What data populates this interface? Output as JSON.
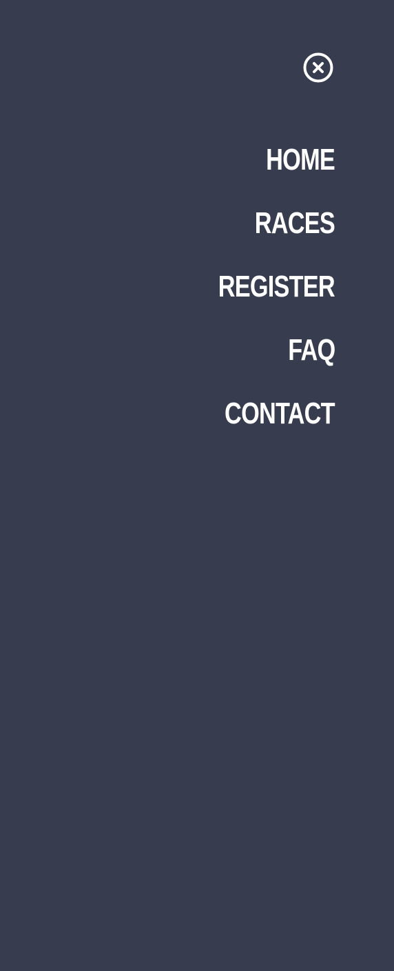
{
  "menu": {
    "close_icon": "close-circle-icon",
    "items": [
      {
        "label": "HOME"
      },
      {
        "label": "RACES"
      },
      {
        "label": "REGISTER"
      },
      {
        "label": "FAQ"
      },
      {
        "label": "CONTACT"
      }
    ]
  },
  "colors": {
    "background": "#383c4f",
    "text": "#ffffff"
  }
}
